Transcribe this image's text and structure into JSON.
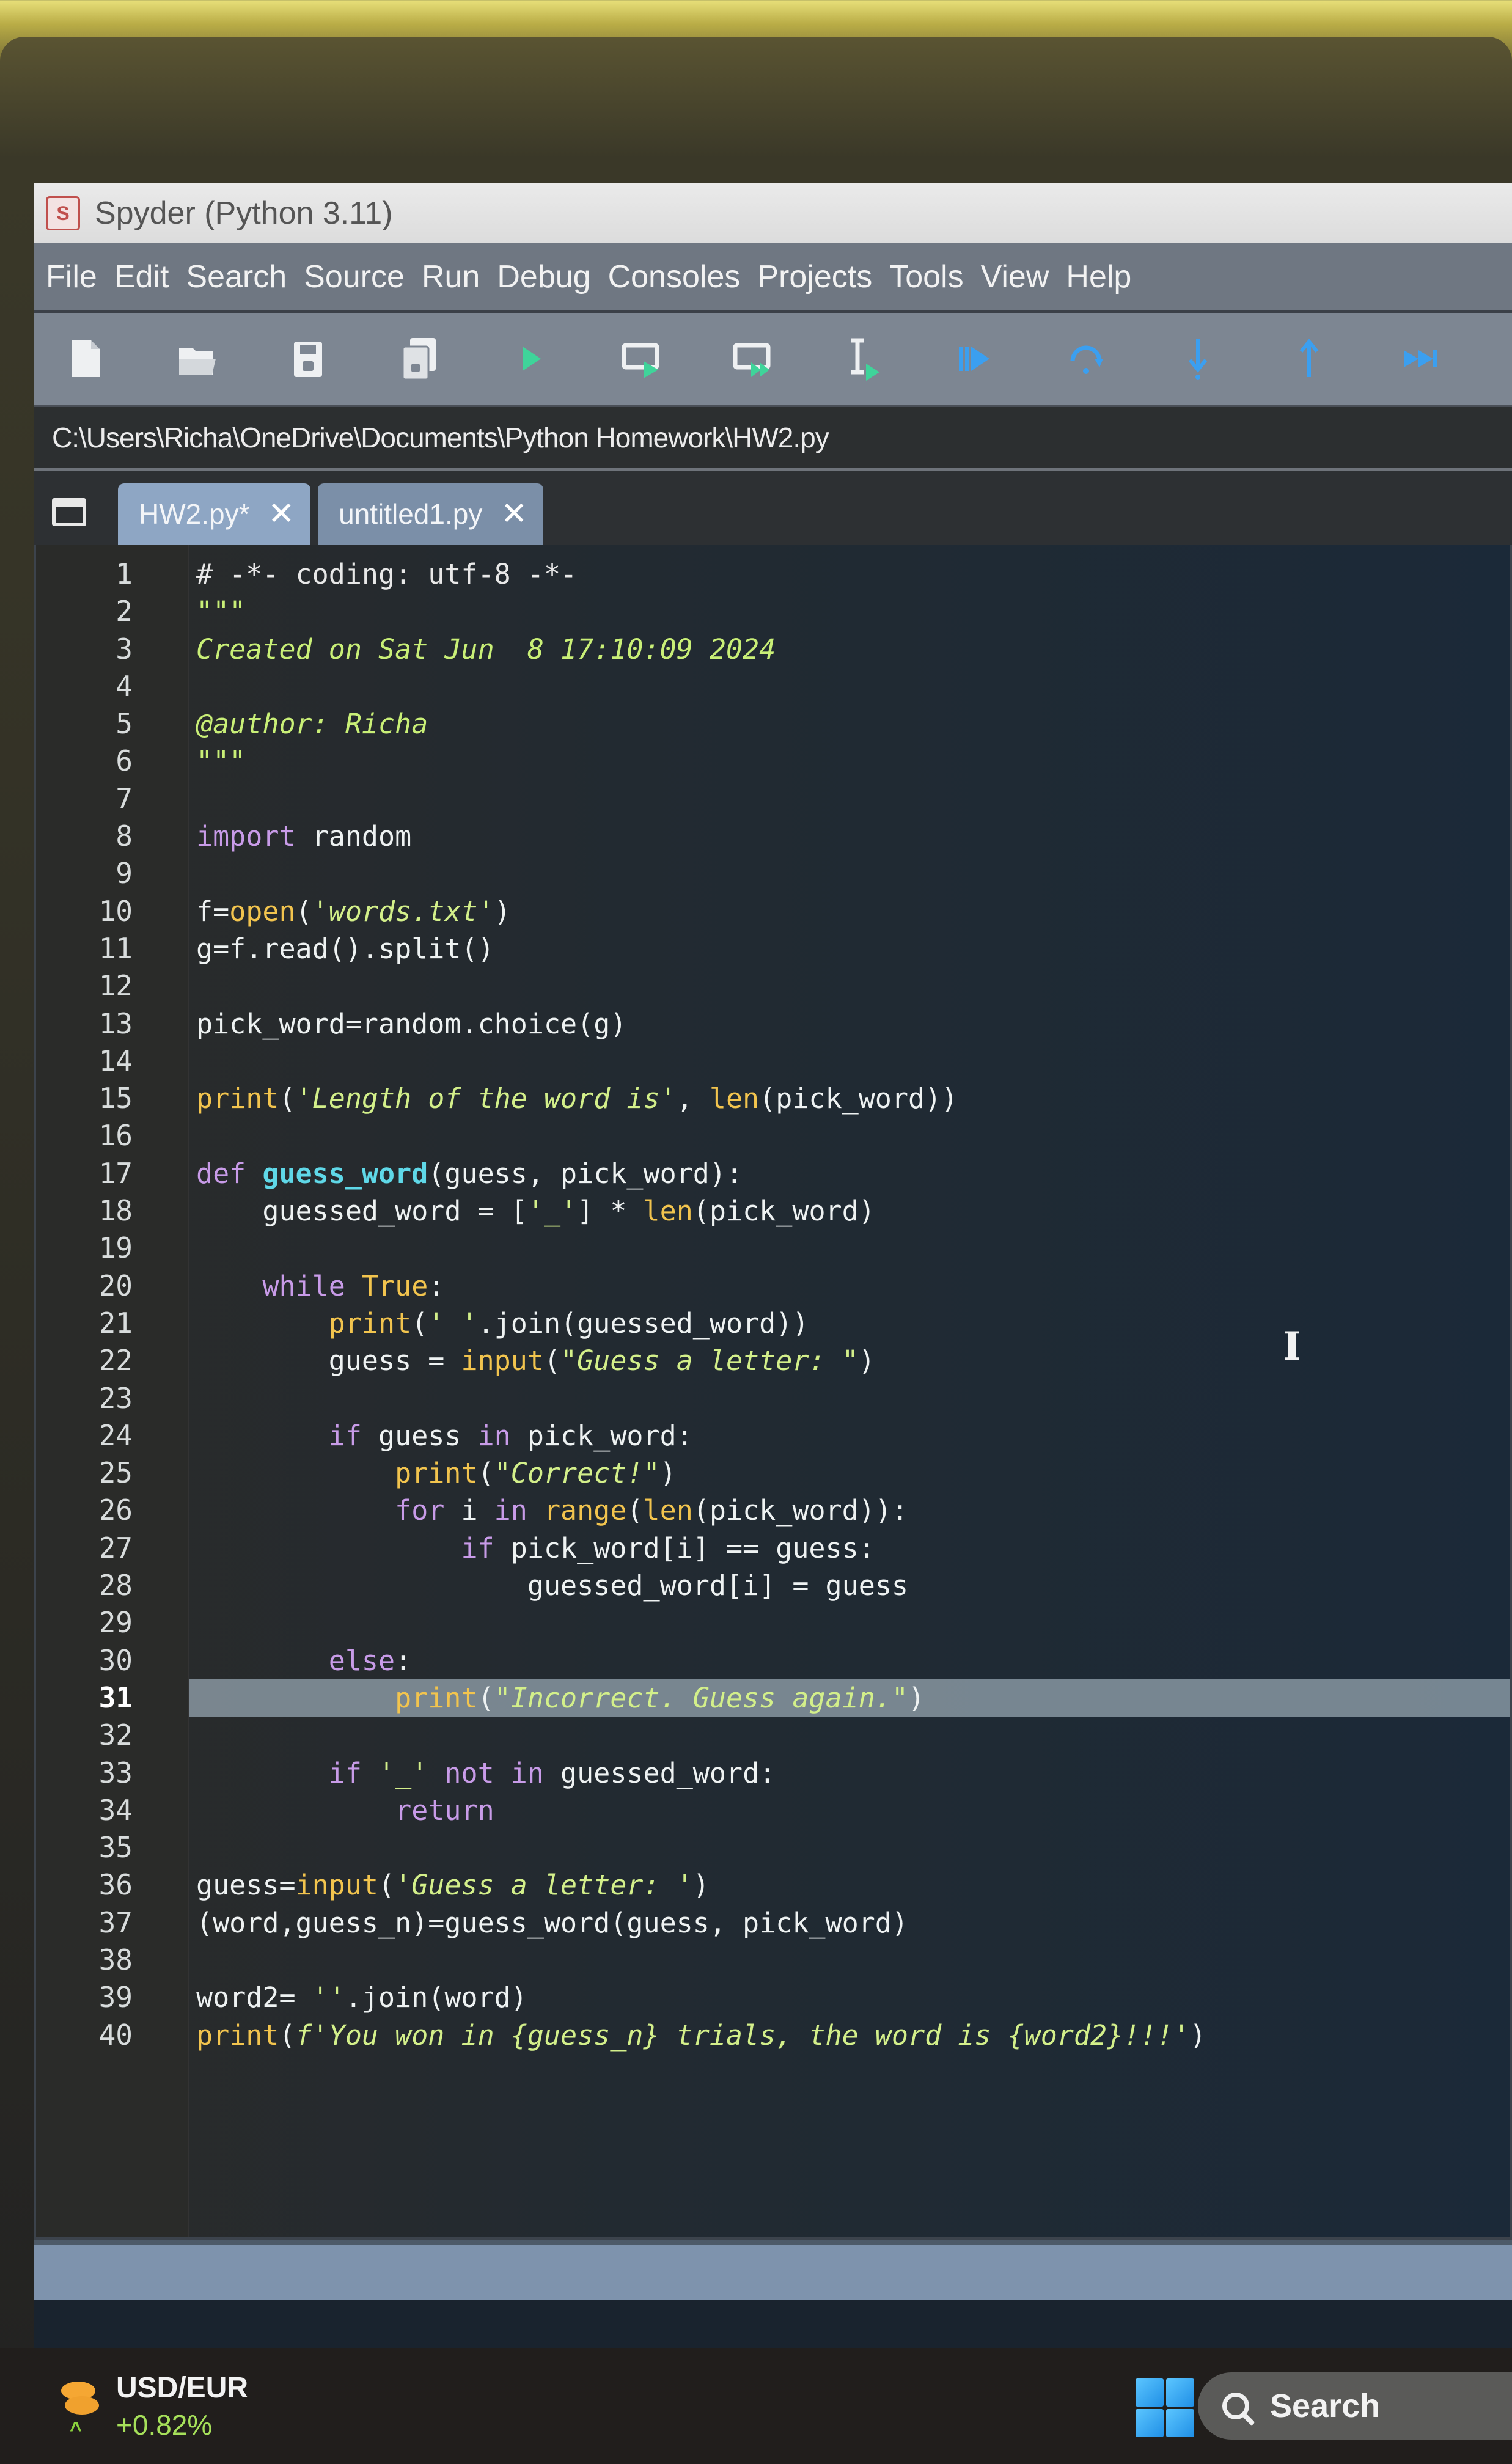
{
  "window": {
    "title": "Spyder (Python 3.11)",
    "app_icon_glyph": "S"
  },
  "menu": [
    "File",
    "Edit",
    "Search",
    "Source",
    "Run",
    "Debug",
    "Consoles",
    "Projects",
    "Tools",
    "View",
    "Help"
  ],
  "toolbar": {
    "buttons": [
      {
        "name": "new-file",
        "icon": "new-file-icon"
      },
      {
        "name": "open-file",
        "icon": "folder-open-icon"
      },
      {
        "name": "save-file",
        "icon": "save-icon"
      },
      {
        "name": "save-all",
        "icon": "save-all-icon"
      },
      {
        "name": "run-file",
        "icon": "play-icon"
      },
      {
        "name": "run-cell",
        "icon": "run-cell-icon"
      },
      {
        "name": "run-cell-advance",
        "icon": "run-cell-advance-icon"
      },
      {
        "name": "run-selection",
        "icon": "run-selection-icon"
      },
      {
        "name": "debug-file",
        "icon": "debug-icon"
      },
      {
        "name": "step-over",
        "icon": "step-over-icon"
      },
      {
        "name": "step-into",
        "icon": "step-into-icon"
      },
      {
        "name": "step-return",
        "icon": "step-return-icon"
      },
      {
        "name": "continue",
        "icon": "continue-icon"
      }
    ]
  },
  "path": "C:\\Users\\Richa\\OneDrive\\Documents\\Python Homework\\HW2.py",
  "tabs": [
    {
      "label": "HW2.py*",
      "active": true
    },
    {
      "label": "untitled1.py",
      "active": false
    }
  ],
  "editor": {
    "current_line": 31,
    "lines": [
      [
        [
          "cm",
          "# -*- coding: utf-8 -*-"
        ]
      ],
      [
        [
          "dc",
          "\"\"\""
        ]
      ],
      [
        [
          "dc",
          "Created on Sat Jun  8 17:10:09 2024"
        ]
      ],
      [],
      [
        [
          "dc",
          "@author: Richa"
        ]
      ],
      [
        [
          "dc",
          "\"\"\""
        ]
      ],
      [],
      [
        [
          "kw",
          "import"
        ],
        [
          "",
          " random"
        ]
      ],
      [],
      [
        [
          "",
          "f="
        ],
        [
          "bi",
          "open"
        ],
        [
          "",
          "("
        ],
        [
          "st",
          "'words.txt'"
        ],
        [
          "",
          ")"
        ]
      ],
      [
        [
          "",
          "g=f.read().split()"
        ]
      ],
      [],
      [
        [
          "",
          "pick_word=random.choice(g)"
        ]
      ],
      [],
      [
        [
          "bi",
          "print"
        ],
        [
          "",
          "("
        ],
        [
          "st",
          "'Length of the word is'"
        ],
        [
          "",
          ", "
        ],
        [
          "bi",
          "len"
        ],
        [
          "",
          "(pick_word))"
        ]
      ],
      [],
      [
        [
          "kw",
          "def"
        ],
        [
          "",
          " "
        ],
        [
          "fn",
          "guess_word"
        ],
        [
          "",
          "(guess, pick_word):"
        ]
      ],
      [
        [
          "",
          "    guessed_word = ["
        ],
        [
          "st",
          "'_'"
        ],
        [
          "",
          "] * "
        ],
        [
          "bi",
          "len"
        ],
        [
          "",
          "(pick_word)"
        ]
      ],
      [],
      [
        [
          "",
          "    "
        ],
        [
          "kw",
          "while"
        ],
        [
          "",
          " "
        ],
        [
          "bi",
          "True"
        ],
        [
          "",
          ":"
        ]
      ],
      [
        [
          "",
          "        "
        ],
        [
          "bi",
          "print"
        ],
        [
          "",
          "("
        ],
        [
          "st",
          "' '"
        ],
        [
          "",
          ".join(guessed_word))"
        ]
      ],
      [
        [
          "",
          "        guess = "
        ],
        [
          "bi",
          "input"
        ],
        [
          "",
          "("
        ],
        [
          "st",
          "\"Guess a letter: \""
        ],
        [
          "",
          ")"
        ]
      ],
      [],
      [
        [
          "",
          "        "
        ],
        [
          "kw",
          "if"
        ],
        [
          "",
          " guess "
        ],
        [
          "kw",
          "in"
        ],
        [
          "",
          " pick_word:"
        ]
      ],
      [
        [
          "",
          "            "
        ],
        [
          "bi",
          "print"
        ],
        [
          "",
          "("
        ],
        [
          "st",
          "\"Correct!\""
        ],
        [
          "",
          ")"
        ]
      ],
      [
        [
          "",
          "            "
        ],
        [
          "kw",
          "for"
        ],
        [
          "",
          " i "
        ],
        [
          "kw",
          "in"
        ],
        [
          "",
          " "
        ],
        [
          "bi",
          "range"
        ],
        [
          "",
          "("
        ],
        [
          "bi",
          "len"
        ],
        [
          "",
          "(pick_word)):"
        ]
      ],
      [
        [
          "",
          "                "
        ],
        [
          "kw",
          "if"
        ],
        [
          "",
          " pick_word[i] == guess:"
        ]
      ],
      [
        [
          "",
          "                    guessed_word[i] = guess"
        ]
      ],
      [],
      [
        [
          "",
          "        "
        ],
        [
          "kw",
          "else"
        ],
        [
          "",
          ":"
        ]
      ],
      [
        [
          "",
          "            "
        ],
        [
          "bi",
          "print"
        ],
        [
          "",
          "("
        ],
        [
          "st",
          "\"Incorrect. Guess again.\""
        ],
        [
          "",
          ")"
        ]
      ],
      [],
      [
        [
          "",
          "        "
        ],
        [
          "kw",
          "if"
        ],
        [
          "",
          " "
        ],
        [
          "st",
          "'_'"
        ],
        [
          "",
          " "
        ],
        [
          "kw",
          "not in"
        ],
        [
          "",
          " guessed_word:"
        ]
      ],
      [
        [
          "",
          "            "
        ],
        [
          "kw",
          "return"
        ]
      ],
      [],
      [
        [
          "",
          "guess="
        ],
        [
          "bi",
          "input"
        ],
        [
          "",
          "("
        ],
        [
          "st",
          "'Guess a letter: '"
        ],
        [
          "",
          ")"
        ]
      ],
      [
        [
          "",
          "(word,guess_n)=guess_word(guess, pick_word)"
        ]
      ],
      [],
      [
        [
          "",
          "word2= "
        ],
        [
          "st",
          "''"
        ],
        [
          "",
          ".join(word)"
        ]
      ],
      [
        [
          "bi",
          "print"
        ],
        [
          "",
          "("
        ],
        [
          "st",
          "f'You won in {guess_n} trials, the word is {word2}!!!'"
        ],
        [
          "",
          ")"
        ]
      ]
    ]
  },
  "taskbar": {
    "widget": {
      "symbol": "USD/EUR",
      "change": "+0.82%",
      "change_color": "#a6e05a"
    },
    "search_label": "Search"
  },
  "colors": {
    "keyword": "#c89be8",
    "builtin": "#f2c44e",
    "string": "#d3ef8a",
    "function_def": "#5fd8e8",
    "current_line_highlight": "#96a6b0"
  }
}
